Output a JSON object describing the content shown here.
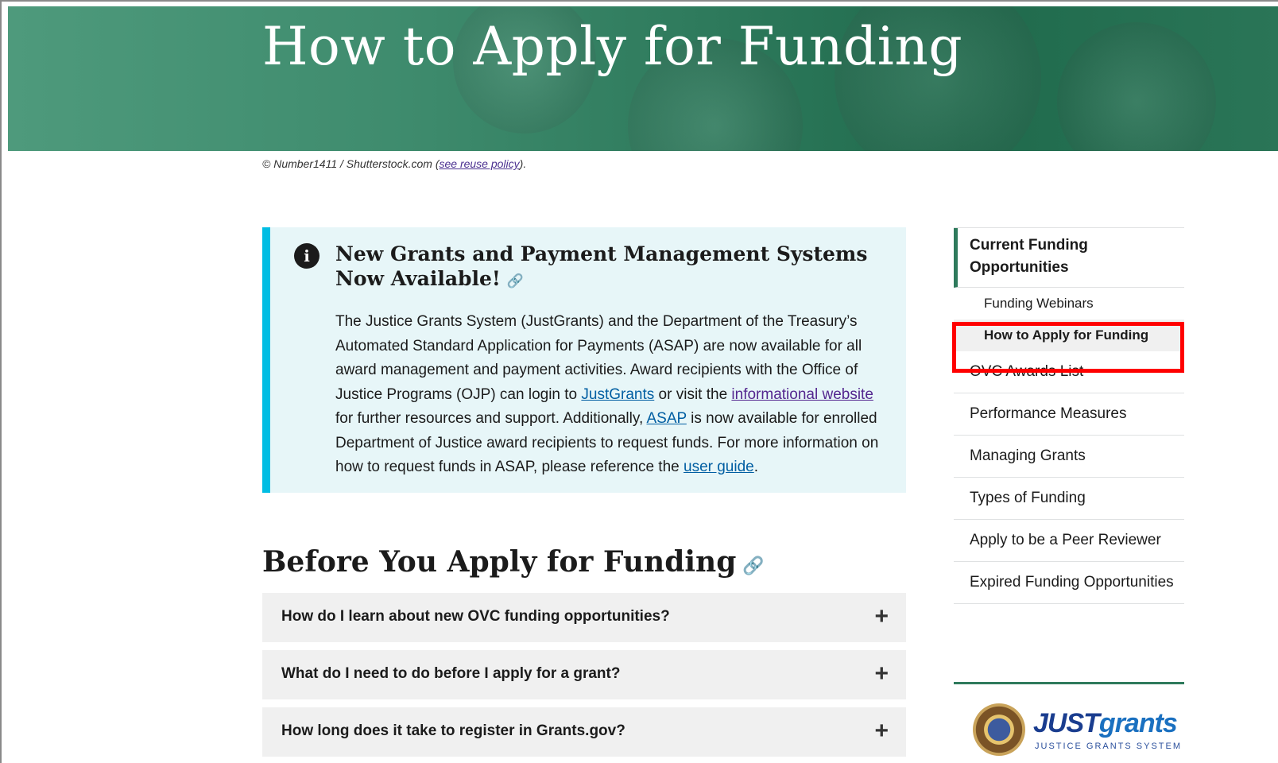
{
  "hero": {
    "title": "How to Apply for Funding"
  },
  "credit": {
    "prefix": "© Number1411 / Shutterstock.com (",
    "link": "see reuse policy",
    "suffix": ")."
  },
  "alert": {
    "title": "New Grants and Payment Management Systems Now Available!",
    "body_1": "The Justice Grants System (JustGrants) and the Department of the Treasury’s Automated Standard Application for Payments (ASAP) are now available for all award management and payment activities. Award recipients with the Office of Justice Programs (OJP) can login to ",
    "link_justgrants": "JustGrants",
    "body_2": " or visit the ",
    "link_info": "informational website",
    "body_3": " for further resources and support. Additionally, ",
    "link_asap": "ASAP",
    "body_4": " is now available for enrolled Department of Justice award recipients to request funds. For more information on how to request funds in ASAP, please reference the ",
    "link_guide": "user guide",
    "body_5": "."
  },
  "section": {
    "title": "Before You Apply for Funding"
  },
  "accordion": [
    "How do I learn about new OVC funding opportunities?",
    "What do I need to do before I apply for a grant?",
    "How long does it take to register in Grants.gov?"
  ],
  "sidenav": {
    "current": "Current Funding Opportunities",
    "sub_1": "Funding Webinars",
    "sub_2": "How to Apply for Funding",
    "items": [
      "OVC Awards List",
      "Performance Measures",
      "Managing Grants",
      "Types of Funding",
      "Apply to be a Peer Reviewer",
      "Expired Funding Opportunities"
    ]
  },
  "justgrants": {
    "brand_a": "JUST",
    "brand_b": "grants",
    "tagline": "JUSTICE GRANTS SYSTEM"
  },
  "colors": {
    "hero": "#2e7a5c",
    "alert_bg": "#e7f6f8",
    "alert_border": "#00bde3",
    "highlight": "#ff0000",
    "link": "#005ea2"
  }
}
